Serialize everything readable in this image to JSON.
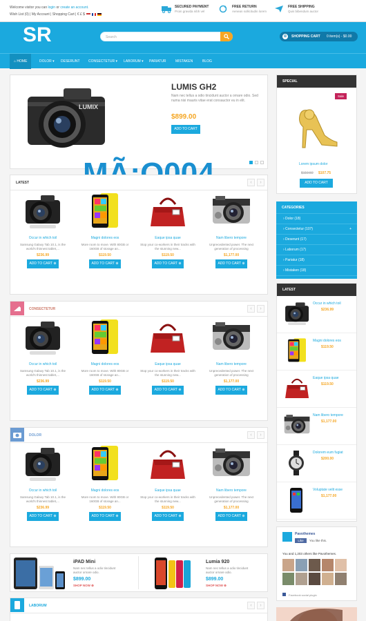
{
  "topbar": {
    "welcome_prefix": "Welcome visitor you can",
    "login": "login",
    "or": "or",
    "create": "create an account.",
    "links": "Wish List (0)  |  My Account  |  Shopping Cart  |  € £ $"
  },
  "services": [
    {
      "icon": "truck-icon",
      "title": "SECURED PAYMENT",
      "sub": "Proin gravida nibh vel"
    },
    {
      "icon": "refresh-icon",
      "title": "FREE RETURN",
      "sub": "Aenean sollicitudin lorem"
    },
    {
      "icon": "plane-icon",
      "title": "FREE SHIPPING",
      "sub": "Quis bibendum auctor"
    }
  ],
  "header": {
    "logo": "SR",
    "search_placeholder": "Search",
    "cart_title": "SHOPPING CART",
    "cart_value": "0 item(s) - $0.00"
  },
  "nav": [
    "HOME",
    "DOLOR ▾",
    "DESERUNT",
    "CONSECTETUR ▾",
    "LABORUM ▾",
    "PARIATUR",
    "MISTAKEN",
    "BLOG"
  ],
  "slider": {
    "title": "LUMIS GH2",
    "desc": "Nam nec tellus a odio tincidunt auctor a ornare odio. Sed numa nisi mauris vitae erat consauctor eu in elit.",
    "price": "$899.00",
    "button": "ADD TO CART"
  },
  "watermark": "MÃ:O004",
  "sections": [
    {
      "title": "LATEST"
    },
    {
      "title": "CONSECTETUR"
    },
    {
      "title": "DOLOR"
    }
  ],
  "products": [
    {
      "name": "Occur in which toil",
      "desc": "Samsung Galaxy Tab 10.1, is the world's thinnest tablet,...",
      "price": "$236.99",
      "button": "ADD TO CART"
    },
    {
      "name": "Magni dolores eos",
      "desc": "More room to move. With 80GB or 160GB of storage an...",
      "price": "$119.50",
      "button": "ADD TO CART"
    },
    {
      "name": "Eaque ipsa quae",
      "desc": "Stop your co-workers in their tracks with the stunning new...",
      "price": "$119.50",
      "button": "ADD TO CART"
    },
    {
      "name": "Nam libero tempore",
      "desc": "Unprecedented power. The next generation of processing",
      "price": "$1,177.00",
      "button": "ADD TO CART"
    }
  ],
  "special": {
    "head": "SPECIAL",
    "badge": "Sale",
    "name": "Lorem ipsum dolor",
    "old_price": "$119.50",
    "price": "$107.75",
    "button": "ADD TO CART"
  },
  "categories": {
    "head": "CATEGORIES",
    "items": [
      "Dolor (18)",
      "Consectetur (107)",
      "Deserunt (17)",
      "Laborum (17)",
      "Pariatur (18)",
      "Mistaken (18)"
    ]
  },
  "side_latest": {
    "head": "LATEST",
    "items": [
      {
        "name": "Occur in which toil",
        "price": "$236.99"
      },
      {
        "name": "Magni dolores eos",
        "price": "$119.50"
      },
      {
        "name": "Eaque ipsa quae",
        "price": "$119.50"
      },
      {
        "name": "Nam libero tempore",
        "price": "$1,177.00"
      },
      {
        "name": "Dolorem eum fugiat",
        "price": "$200.00"
      },
      {
        "name": "Voluptate velit esse",
        "price": "$1,177.00"
      }
    ]
  },
  "facebook": {
    "name": "Pavothemes",
    "like": "Like",
    "you_like": "You like this.",
    "others": "You and 1,203 others like Pavothemes.",
    "plugin": "Facebook social plugin"
  },
  "banners": [
    {
      "title": "iPAD Mini",
      "desc": "Nam nec tellus a odio tincidunt auctor ornare odio.",
      "price": "$899.00",
      "shop": "SHOP NOW"
    },
    {
      "title": "Lumia 920",
      "desc": "Nam nec tellus a odio tincidunt auctor ornare odio.",
      "price": "$899.00",
      "shop": "SHOP NOW"
    }
  ],
  "section4": {
    "title": "LABORUM"
  },
  "colors": {
    "accent": "#1ba9de",
    "price": "#f5a623"
  }
}
